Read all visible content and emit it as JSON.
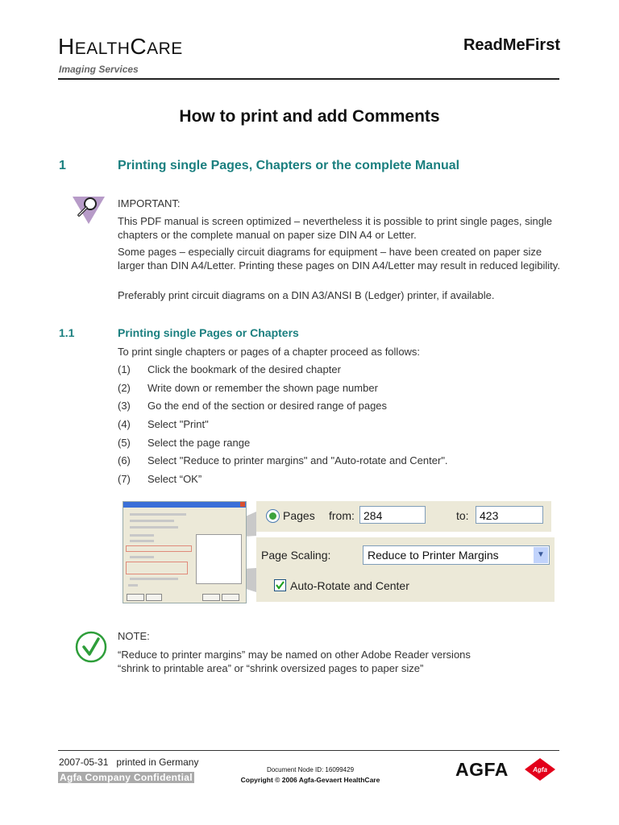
{
  "header": {
    "brand_first_h": "H",
    "brand_ealth": "EALTH",
    "brand_c": "C",
    "brand_are": "ARE",
    "subbrand": "Imaging Services",
    "doc_label": "ReadMeFirst"
  },
  "title": "How to print and add Comments",
  "section1": {
    "number": "1",
    "heading": "Printing single Pages, Chapters or the complete Manual",
    "important": {
      "icon": "magnifier-warning-icon",
      "label": "IMPORTANT:",
      "paragraphs": [
        "This PDF manual is screen optimized – nevertheless it is possible to print single pages, single chapters or the complete manual on paper size DIN A4 or Letter.",
        "Some pages – especially circuit diagrams for equipment – have been created on paper size larger than DIN A4/Letter. Printing these pages on DIN A4/Letter may result in reduced legibility.",
        "Preferably print circuit diagrams on a DIN A3/ANSI B (Ledger) printer, if available."
      ]
    }
  },
  "section1_1": {
    "number": "1.1",
    "heading": "Printing single Pages or Chapters",
    "intro": "To print single chapters or pages of a chapter proceed as follows:",
    "steps": [
      {
        "n": "(1)",
        "text": "Click the bookmark of the desired chapter"
      },
      {
        "n": "(2)",
        "text": "Write down or remember the shown page number"
      },
      {
        "n": "(3)",
        "text": "Go the end of the section or desired range of pages"
      },
      {
        "n": "(4)",
        "text": "Select \"Print\""
      },
      {
        "n": "(5)",
        "text": "Select the page range"
      },
      {
        "n": "(6)",
        "text": "Select \"Reduce to printer margins\" and \"Auto-rotate and Center\"."
      },
      {
        "n": "(7)",
        "text": "Select “OK”"
      }
    ]
  },
  "print_dialog": {
    "pages_label": "Pages",
    "from_label": "from:",
    "from_value": "284",
    "to_label": "to:",
    "to_value": "423",
    "page_scaling_label": "Page Scaling:",
    "page_scaling_value": "Reduce to Printer Margins",
    "auto_rotate_label": "Auto-Rotate and Center",
    "auto_rotate_checked": true,
    "pages_radio_selected": true
  },
  "note": {
    "icon": "checkmark-circle-icon",
    "label": "NOTE:",
    "text_line1": "“Reduce to printer margins” may be named on other Adobe Reader versions",
    "text_line2": "“shrink to printable area” or “shrink oversized pages to paper size”"
  },
  "footer": {
    "date": "2007-05-31",
    "printed": "printed in Germany",
    "confidential": "Agfa Company Confidential",
    "node_id": "Document Node ID: 16099429",
    "copyright": "Copyright © 2006 Agfa-Gevaert HealthCare",
    "logo_word": "AGFA",
    "logo_badge": "Agfa"
  },
  "colors": {
    "heading_teal": "#1a7f7f",
    "important_icon": "#b79bc8",
    "note_icon": "#2e9e3a",
    "agfa_red": "#e3001b"
  }
}
